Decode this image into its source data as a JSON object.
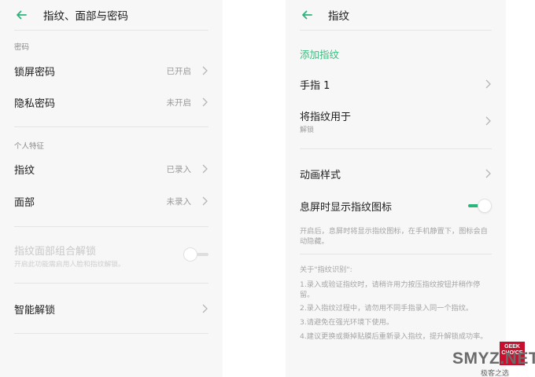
{
  "left": {
    "title": "指纹、面部与密码",
    "section_password": "密码",
    "lock_password": {
      "label": "锁屏密码",
      "value": "已开启"
    },
    "privacy_password": {
      "label": "隐私密码",
      "value": "未开启"
    },
    "section_personal": "个人特征",
    "fingerprint": {
      "label": "指纹",
      "value": "已录入"
    },
    "face": {
      "label": "面部",
      "value": "未录入"
    },
    "combo_unlock": {
      "title": "指纹面部组合解锁",
      "desc": "开启此功能需启用人脸和指纹解锁。",
      "enabled": false
    },
    "smart_unlock": {
      "label": "智能解锁"
    }
  },
  "right": {
    "title": "指纹",
    "add_fingerprint": "添加指纹",
    "finger1": {
      "label": "手指 1"
    },
    "use_for": {
      "label": "将指纹用于",
      "sub": "解锁"
    },
    "animation": {
      "label": "动画样式"
    },
    "show_icon": {
      "label": "息屏时显示指纹图标",
      "enabled": true
    },
    "show_icon_desc": "开启后，息屏时将显示指纹图标，在手机静置下，图标会自动隐藏。",
    "about_title": "关于\"指纹识别\":",
    "notes": [
      "1.录入或验证指纹时，请稍许用力按压指纹按钮并稍作停留。",
      "2.录入指纹过程中，请勿用不同手指录入同一个指纹。",
      "3.请避免在强光环境下使用。",
      "4.建议更换或撕掉贴膜后重新录入指纹，提升解锁成功率。"
    ]
  },
  "watermark": {
    "logo_line1": "GEEK",
    "logo_line2": "CHOICE",
    "text": "SMYZ.NET",
    "sub": "极客之选"
  },
  "colors": {
    "accent_green": "#3dbb7f",
    "toggle_on": "#29b57c",
    "background": "#f7f7f7"
  },
  "icons": {
    "back": "arrow-left-icon",
    "chevron": "chevron-right-icon"
  }
}
